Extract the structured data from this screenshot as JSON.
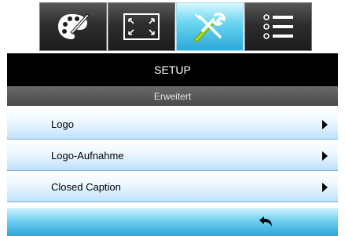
{
  "tabs": [
    {
      "icon": "palette-icon",
      "active": false
    },
    {
      "icon": "screen-resize-icon",
      "active": false
    },
    {
      "icon": "setup-tools-icon",
      "active": true
    },
    {
      "icon": "options-list-icon",
      "active": false
    }
  ],
  "header": {
    "title": "SETUP",
    "subtitle": "Erweitert"
  },
  "menu": {
    "items": [
      {
        "label": "Logo"
      },
      {
        "label": "Logo-Aufnahme"
      },
      {
        "label": "Closed Caption"
      }
    ]
  },
  "footer": {
    "icon": "back-arrow-icon"
  },
  "colors": {
    "accent": "#2aa9d9",
    "title_bg": "#000000",
    "item_bg_bottom": "#bfe2fb"
  }
}
